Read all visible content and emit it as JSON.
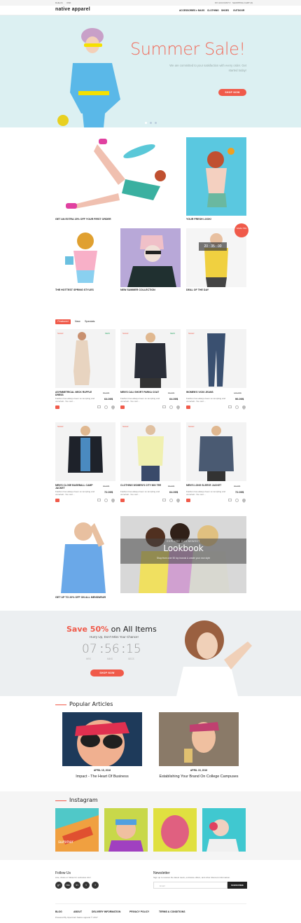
{
  "topbar": {
    "currency": "Dollar $",
    "language": "USD",
    "account": "MY ACCOUNT ▾",
    "cart": "SHOPPING CART (0)"
  },
  "header": {
    "logo": "native apparel",
    "nav": [
      "ACCESSORIES ▾",
      "BAGS",
      "CLOTHING",
      "SHOES",
      "OUTDOOR"
    ]
  },
  "hero": {
    "title": "Summer Sale!",
    "subtitle": "We are committed to your satisfaction with every order. Get started today!",
    "button": "SHOP NOW"
  },
  "banners": {
    "first_order": "GET AN EXTRA 15% OFF YOUR FIRST ORDER",
    "fresh_look": "YOUR FRESH LOOK!",
    "spring": "THE HOTTEST SPRING STYLES",
    "summer": "NEW SUMMER COLLECTION",
    "deal": "DEAL OF THE DAY",
    "save_badge": "SAVE 70%",
    "timer": "20 : 35 : 00",
    "menswear": "GET UP TO 20% OFF ON ALL MENSWEAR",
    "lookbook_kicker": "EXPLORE OUR NEWEST",
    "lookbook": "Lookbook",
    "lookbook_sub": "Shop from over 50 top brands & create your own style"
  },
  "tabs": [
    "Featured",
    "New",
    "Specials"
  ],
  "products": [
    {
      "sale": "SALE!",
      "new": "NEW",
      "name": "ASYMMETRICAL NECK RUFFLE DRESS",
      "desc": "Fashion has always been so tempting and uncertain. You can'...",
      "old": "80.00$",
      "price": "64.00$"
    },
    {
      "sale": "SALE!",
      "new": "NEW",
      "name": "MEN'S CALI SHORT PARKA COAT",
      "desc": "Fashion has always been so tempting and uncertain. You can'...",
      "old": "80.00$",
      "price": "64.00$"
    },
    {
      "sale": "SALE!",
      "new": "",
      "name": "WOMEN'S VICKI JEANS",
      "desc": "Fashion has always been so tempting and uncertain. You can'...",
      "old": "120.00$",
      "price": "96.00$"
    },
    {
      "sale": "SALE!",
      "new": "",
      "name": "MEN'S CLOSE BASEBALL CAMP JACKET",
      "desc": "Fashion has always been so tempting and uncertain. You can'...",
      "old": "90.00$",
      "price": "72.00$"
    },
    {
      "sale": "SALE!",
      "new": "",
      "name": "CLOTHING WOMEN'S CITY MIX TEE",
      "desc": "Fashion has always been so tempting and uncertain. You can'...",
      "old": "80.00$",
      "price": "64.00$"
    },
    {
      "sale": "SALE!",
      "new": "",
      "name": "MEN'S LONG SLEEVE JACKET",
      "desc": "Fashion has always been so tempting and uncertain. You can'...",
      "old": "90.00$",
      "price": "72.00$"
    }
  ],
  "promo": {
    "title_a": "Save 50%",
    "title_b": " on All Items",
    "sub": "Hurry Up, Don't Miss Your Chance!",
    "h": "07",
    "m": "56",
    "s": "15",
    "hl": "HRS",
    "ml": "MINS",
    "sl": "SECS",
    "button": "SHOP NOW"
  },
  "articles": {
    "title": "Popular Articles",
    "items": [
      {
        "date": "APRIL 15, 2016",
        "title": "Impact - The Heart Of Business"
      },
      {
        "date": "APRIL 15, 2016",
        "title": "Establishing Your Brand On College Campuses"
      }
    ]
  },
  "instagram": {
    "title": "Instagram",
    "tile_text": "summer"
  },
  "footer": {
    "follow": "Follow Us",
    "follow_sub": "Like, share or follow for exclusive info!",
    "social": [
      "g+",
      "rss",
      "in",
      "t",
      "f"
    ],
    "newsletter": "Newsletter",
    "newsletter_sub": "Sign up to receive the latest news, exclusive offers, and other discount information.",
    "email_placeholder": "Email",
    "subscribe": "SUBSCRIBE",
    "links": [
      "BLOG",
      "ABOUT",
      "DELIVERY INFORMATION",
      "PRIVACY POLICY",
      "TERMS & CONDITIONS"
    ],
    "copyright": "Powered By OpenCart Native apparel © 2017"
  },
  "colors": {
    "accent": "#f05a4a",
    "hero_bg": "#dcf0f2",
    "promo_bg": "#eceff1"
  }
}
